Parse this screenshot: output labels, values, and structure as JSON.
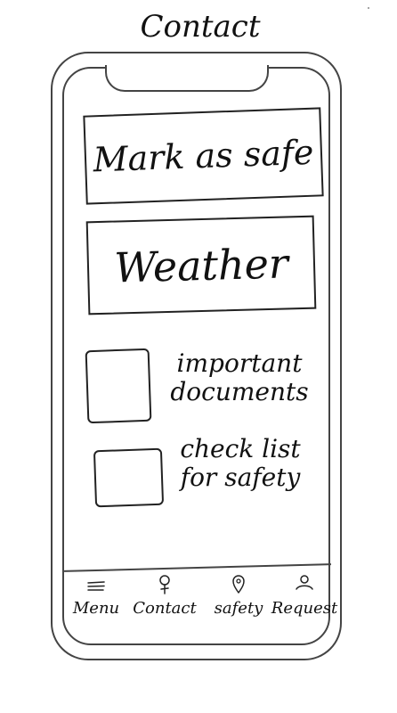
{
  "page": {
    "title": "Contact"
  },
  "main": {
    "mark_safe_label": "Mark as safe",
    "weather_label": "Weather",
    "items": [
      {
        "label_line1": "important",
        "label_line2": "documents"
      },
      {
        "label_line1": "check list",
        "label_line2": "for safety"
      }
    ]
  },
  "nav": {
    "items": [
      {
        "label": "Menu",
        "icon": "hamburger-icon"
      },
      {
        "label": "Contact",
        "icon": "person-icon"
      },
      {
        "label": "safety",
        "icon": "location-pin-icon"
      },
      {
        "label": "Request",
        "icon": "person-icon"
      }
    ]
  }
}
